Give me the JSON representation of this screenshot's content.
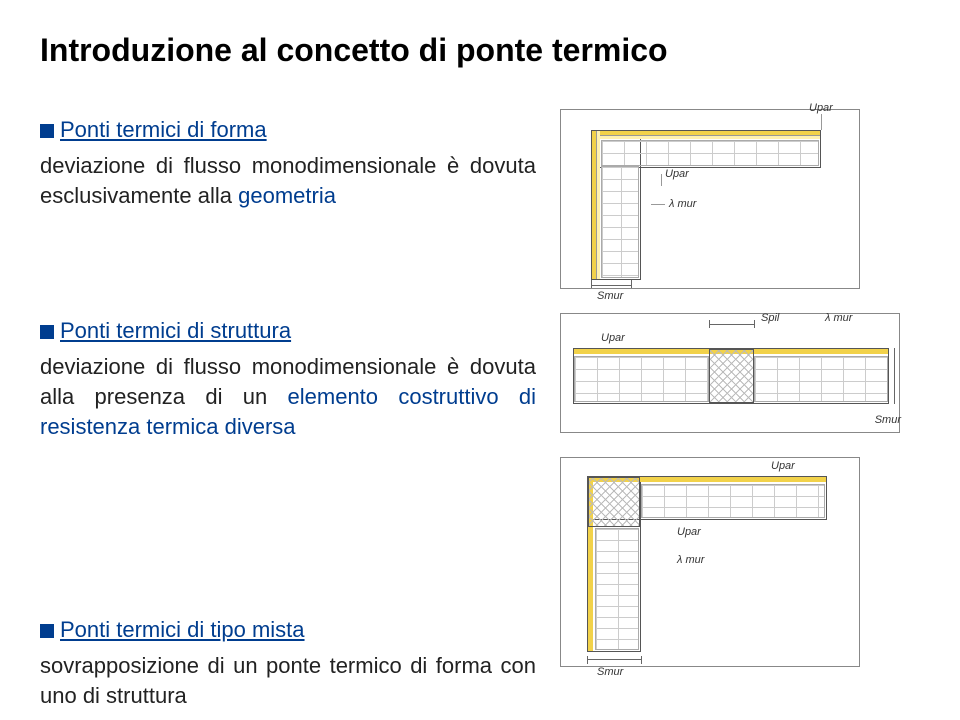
{
  "title": "Introduzione al concetto di ponte termico",
  "sections": [
    {
      "heading": "Ponti termici di forma",
      "body_pre": "deviazione di flusso monodimensionale è dovuta esclusivamente alla ",
      "body_blue": "geometria",
      "body_post": ""
    },
    {
      "heading": "Ponti termici di struttura",
      "body_pre": "deviazione di flusso monodimensionale è dovuta alla presenza di un ",
      "body_blue": "elemento costruttivo di resistenza termica diversa",
      "body_post": ""
    },
    {
      "heading": "Ponti termici di tipo mista",
      "body_pre": "sovrapposizione di un ponte termico di forma con uno di struttura",
      "body_blue": "",
      "body_post": ""
    }
  ],
  "diagrams": {
    "d1": {
      "u_par": "Upar",
      "lambda_mur": "λ mur",
      "s_mur": "Smur"
    },
    "d2": {
      "u_par": "Upar",
      "s_pil": "Spil",
      "lambda_mur": "λ mur",
      "s_mur": "Smur"
    },
    "d3": {
      "u_par": "Upar",
      "lambda_mur": "λ mur",
      "s_mur": "Smur"
    }
  }
}
